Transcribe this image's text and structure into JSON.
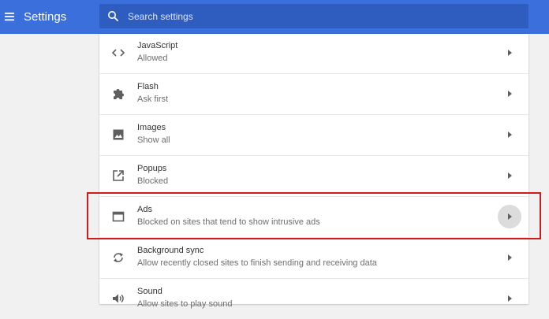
{
  "header": {
    "title": "Settings",
    "menu_icon": "hamburger-menu-icon",
    "background_color": "#3b6fdc"
  },
  "search": {
    "placeholder": "Search settings",
    "value": "",
    "icon": "search-icon",
    "background_color": "#2e5dbf"
  },
  "settings_list": {
    "items": [
      {
        "title": "JavaScript",
        "subtitle": "Allowed",
        "icon": "code-brackets-icon",
        "hovered": false
      },
      {
        "title": "Flash",
        "subtitle": "Ask first",
        "icon": "puzzle-piece-icon",
        "hovered": false
      },
      {
        "title": "Images",
        "subtitle": "Show all",
        "icon": "image-icon",
        "hovered": false
      },
      {
        "title": "Popups",
        "subtitle": "Blocked",
        "icon": "open-in-new-icon",
        "hovered": false
      },
      {
        "title": "Ads",
        "subtitle": "Blocked on sites that tend to show intrusive ads",
        "icon": "window-icon",
        "hovered": true
      },
      {
        "title": "Background sync",
        "subtitle": "Allow recently closed sites to finish sending and receiving data",
        "icon": "sync-icon",
        "hovered": false
      },
      {
        "title": "Sound",
        "subtitle": "Allow sites to play sound",
        "icon": "volume-icon",
        "hovered": false
      }
    ],
    "chevron_icon": "chevron-right-icon"
  },
  "annotation": {
    "highlight_color": "#d11a1a",
    "highlighted_item": "Ads"
  }
}
